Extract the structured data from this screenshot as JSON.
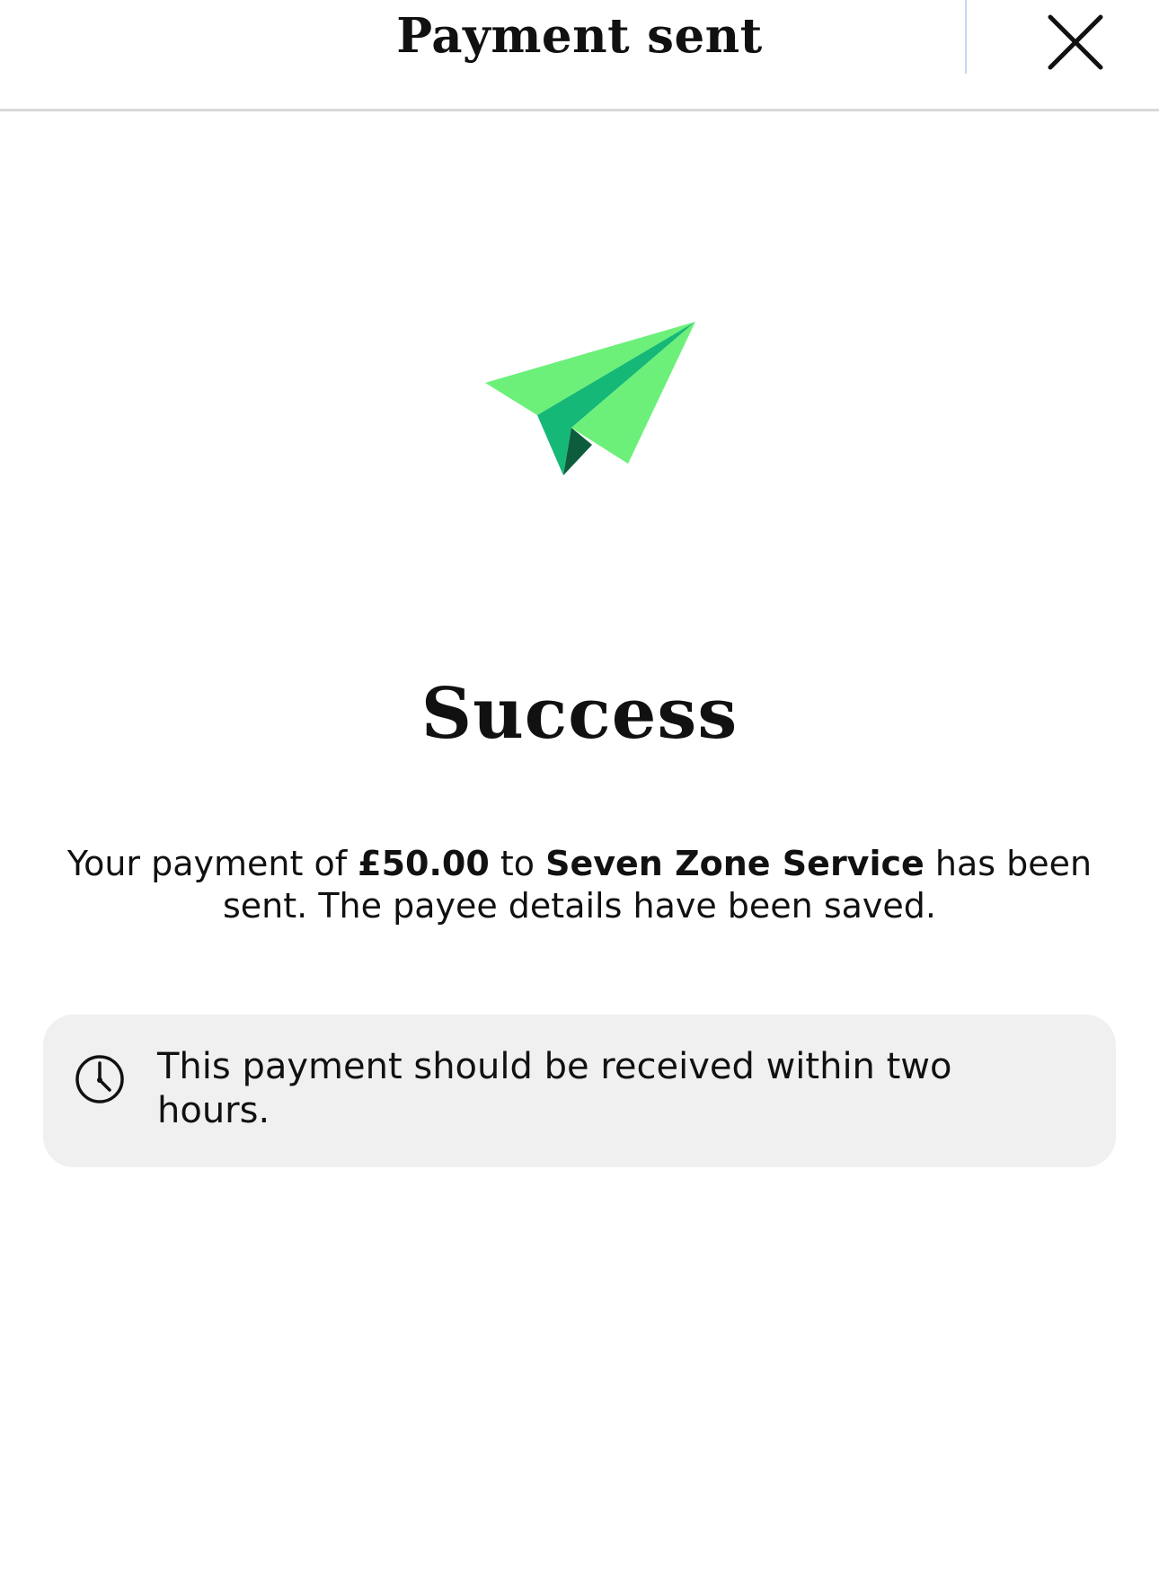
{
  "header": {
    "title": "Payment sent",
    "close_icon": "close-icon"
  },
  "illustration": {
    "icon": "paper-plane-icon",
    "colors": {
      "light_green": "#6cf07a",
      "mid_green": "#16b877",
      "dark_green": "#0d5c3b"
    }
  },
  "main": {
    "headline": "Success",
    "message": {
      "prefix": "Your payment of ",
      "amount": "£50.00",
      "middle": " to ",
      "payee": "Seven Zone Service",
      "suffix": " has been sent. The payee details have been saved."
    }
  },
  "info": {
    "icon": "clock-icon",
    "text": "This payment should be received within two hours.",
    "background": "#f0f0f0"
  }
}
